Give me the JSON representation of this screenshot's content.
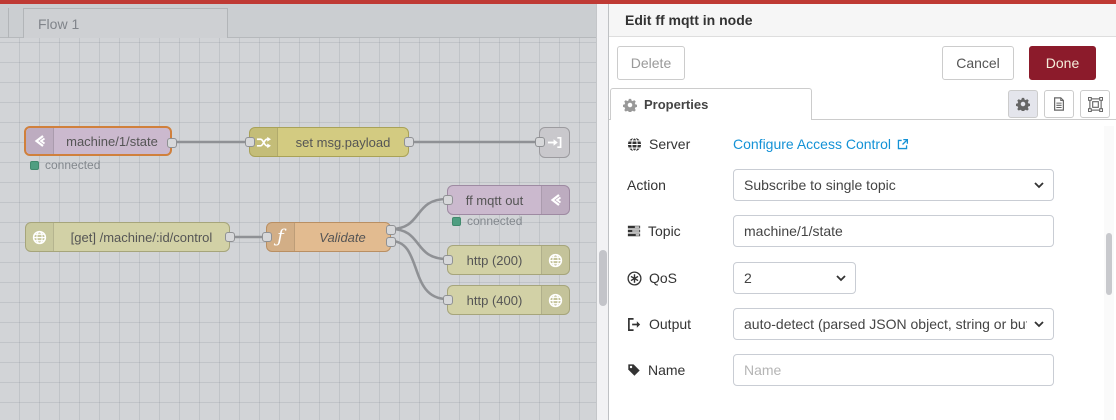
{
  "canvas": {
    "flow_tab": "Flow 1",
    "nodes": {
      "mqtt_in": {
        "label": "machine/1/state",
        "status": "connected"
      },
      "change": {
        "label": "set msg.payload"
      },
      "http_in": {
        "label": "[get] /machine/:id/control"
      },
      "function": {
        "label": "Validate"
      },
      "mqtt_out": {
        "label": "ff mqtt out",
        "status": "connected"
      },
      "http_200": {
        "label": "http (200)"
      },
      "http_400": {
        "label": "http (400)"
      }
    }
  },
  "panel": {
    "title": "Edit ff mqtt in node",
    "delete_label": "Delete",
    "cancel_label": "Cancel",
    "done_label": "Done",
    "tab_label": "Properties",
    "fields": {
      "server": {
        "label": "Server",
        "link_text": "Configure Access Control"
      },
      "action": {
        "label": "Action",
        "value": "Subscribe to single topic"
      },
      "topic": {
        "label": "Topic",
        "value": "machine/1/state"
      },
      "qos": {
        "label": "QoS",
        "value": "2"
      },
      "output": {
        "label": "Output",
        "value": "auto-detect (parsed JSON object, string or buffer)"
      },
      "name": {
        "label": "Name",
        "placeholder": "Name"
      }
    }
  },
  "colors": {
    "top_bar_red": "#bf3a34",
    "done_button": "#8c1b2b",
    "link_blue": "#1492d6",
    "status_green": "#4f9e81",
    "selection_orange": "#d0803c",
    "mqtt_node": "#cbb9ce",
    "change_node": "#d3cb81",
    "http_node": "#d2d1a6",
    "function_node": "#e2bb90"
  }
}
